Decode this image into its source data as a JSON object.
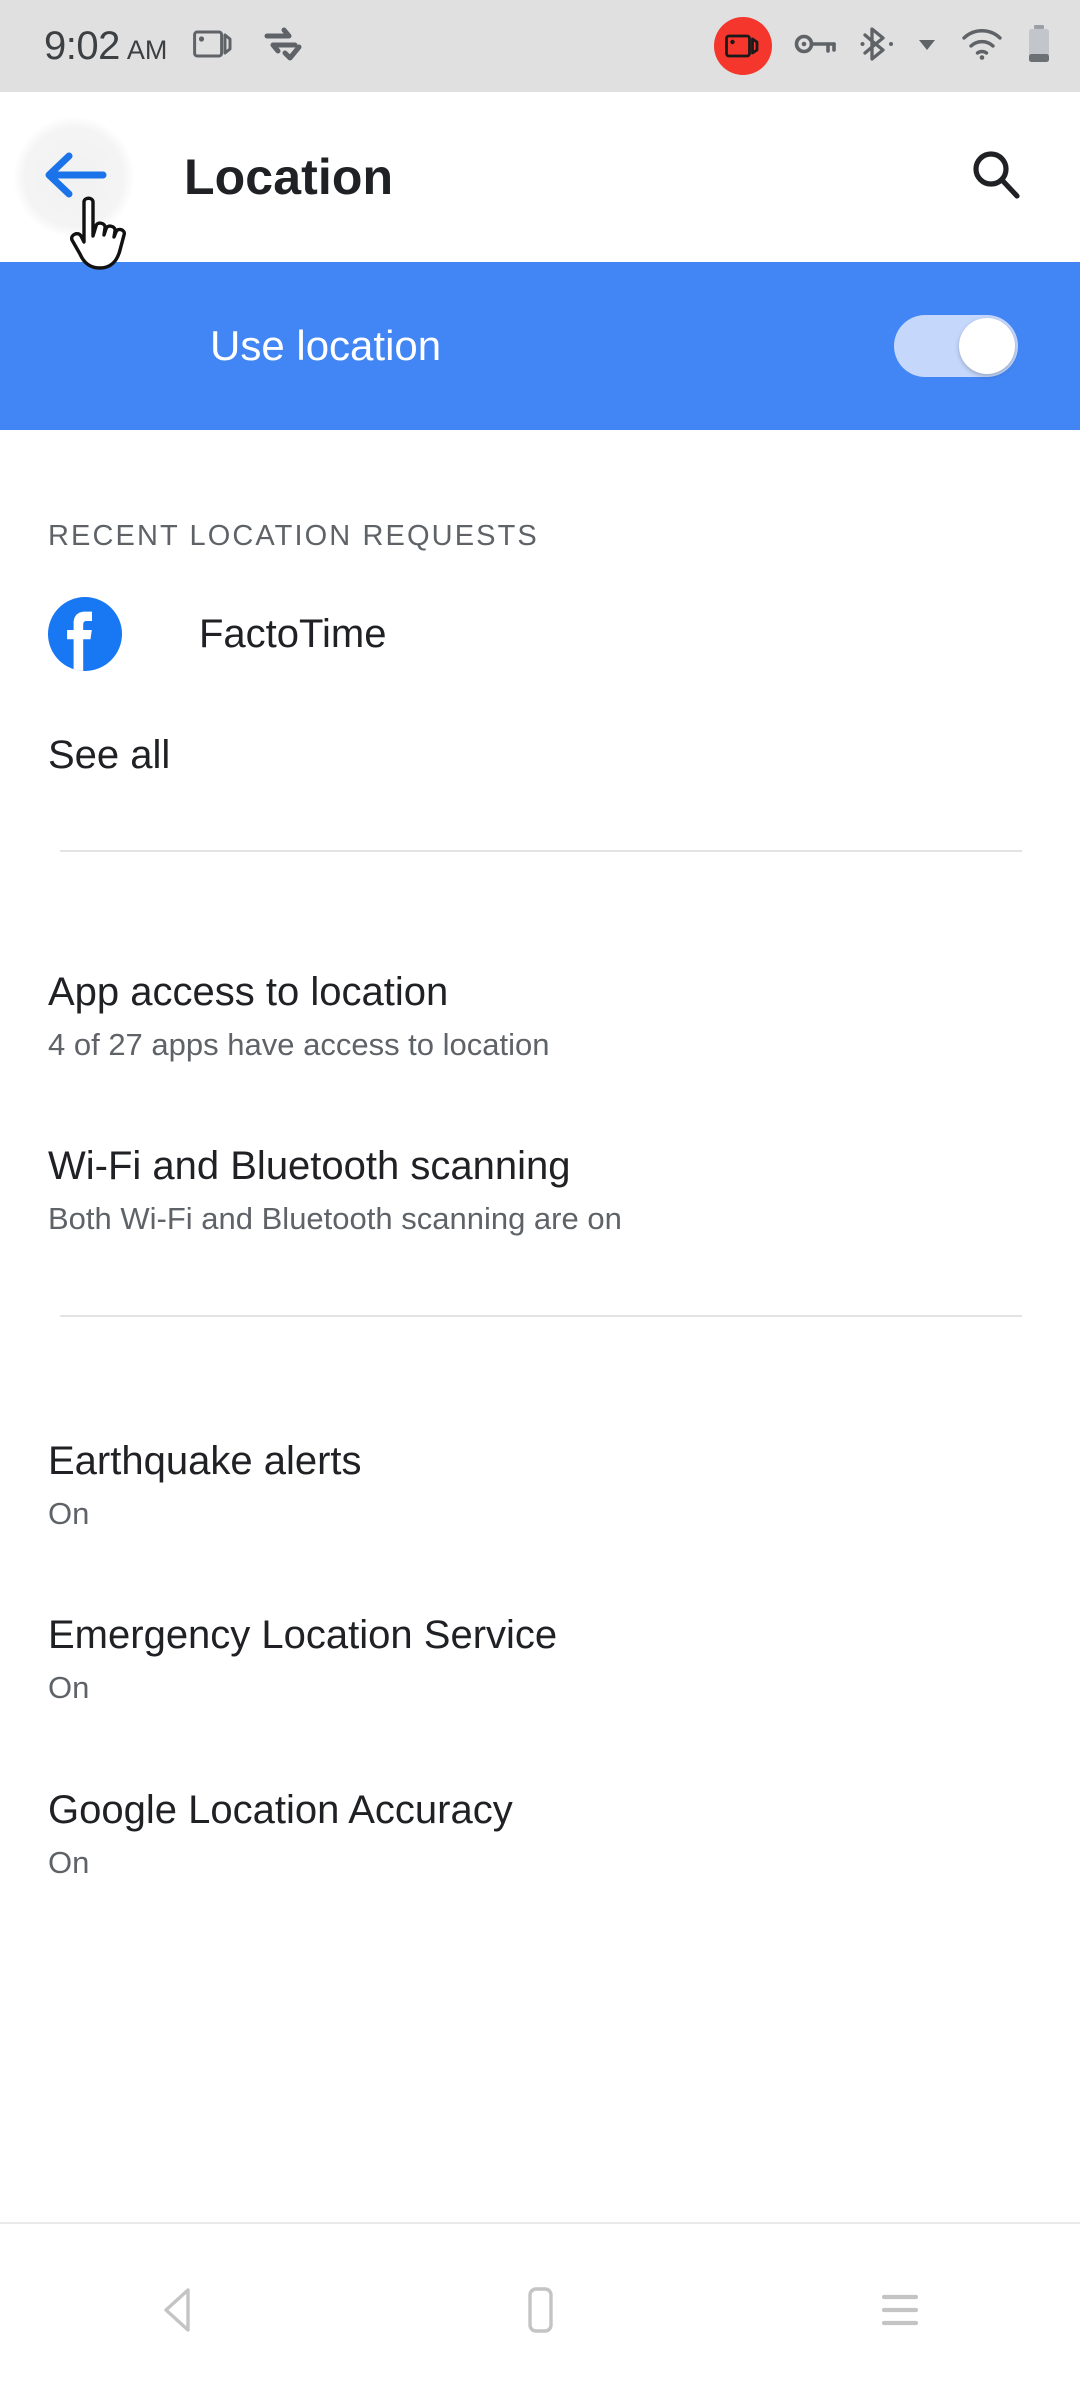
{
  "status_bar": {
    "time": "9:02",
    "am_pm": "AM",
    "left_icons": [
      {
        "name": "screen-record-icon",
        "label": "screen-record"
      },
      {
        "name": "data-saver-icon",
        "label": "data-saver"
      }
    ],
    "right_icons": [
      {
        "name": "screen-record-active-icon",
        "label": "recording",
        "color": "#f4362c"
      },
      {
        "name": "vpn-key-icon",
        "label": "vpn"
      },
      {
        "name": "bluetooth-icon",
        "label": "bluetooth"
      },
      {
        "name": "signal-caret-icon",
        "label": "network-caret"
      },
      {
        "name": "wifi-icon",
        "label": "wifi"
      },
      {
        "name": "battery-icon",
        "label": "battery"
      }
    ],
    "background": "#e0e0e0"
  },
  "app_bar": {
    "title": "Location",
    "back_icon": "arrow-back-icon",
    "search_icon": "search-icon",
    "back_color": "#1a73e8"
  },
  "master_switch": {
    "label": "Use location",
    "state": "on",
    "banner_color": "#4285f4",
    "track_color": "#c5d7fb",
    "thumb_color": "#ffffff"
  },
  "recent": {
    "header": "RECENT LOCATION REQUESTS",
    "apps": [
      {
        "name": "FactoTime",
        "icon": "facebook-f-icon",
        "icon_color": "#1877f2"
      }
    ],
    "see_all": "See all"
  },
  "preferences": [
    {
      "key": "app-access-to-location",
      "title": "App access to location",
      "subtitle": "4 of 27 apps have access to location"
    },
    {
      "key": "wifi-bluetooth-scanning",
      "title": "Wi-Fi and Bluetooth scanning",
      "subtitle": "Both Wi-Fi and Bluetooth scanning are on"
    },
    {
      "key": "earthquake-alerts",
      "title": "Earthquake alerts",
      "subtitle": "On"
    },
    {
      "key": "emergency-location-service",
      "title": "Emergency Location Service",
      "subtitle": "On"
    },
    {
      "key": "google-location-accuracy",
      "title": "Google Location Accuracy",
      "subtitle": "On"
    }
  ],
  "nav_bar": {
    "back": "nav-back-icon",
    "home": "nav-home-icon",
    "recents": "nav-recents-icon"
  }
}
